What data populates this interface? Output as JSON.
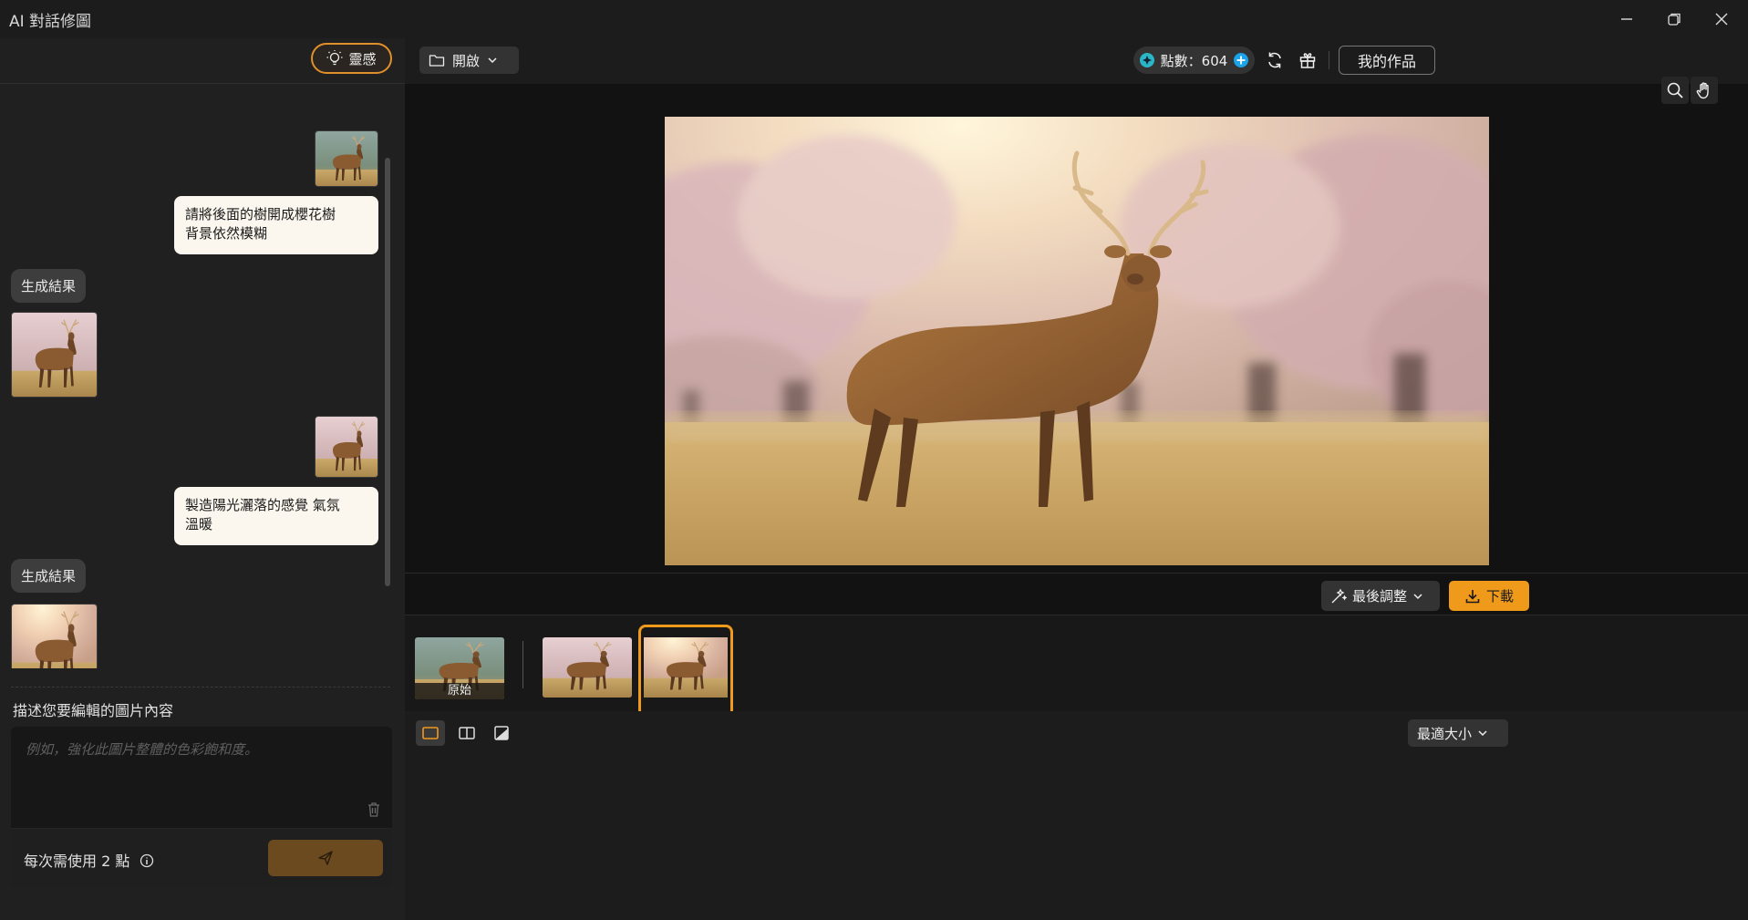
{
  "window": {
    "title": "AI 對話修圖"
  },
  "left_panel": {
    "inspiration_label": "靈感",
    "messages": [
      {
        "role": "user",
        "text": "請將後面的樹開成櫻花樹\n背景依然模糊"
      },
      {
        "role": "assistant",
        "tag": "生成結果"
      },
      {
        "role": "user",
        "text": "製造陽光灑落的感覺 氣氛\n溫暖"
      },
      {
        "role": "assistant",
        "tag": "生成結果"
      }
    ],
    "description_label": "描述您要編輯的圖片內容",
    "input_placeholder": "例如，強化此圖片整體的色彩飽和度。",
    "input_value": "",
    "cost_text": "每次需使用 2 點"
  },
  "toolbar": {
    "open_label": "開啟",
    "points_label": "點數：604",
    "my_works_label": "我的作品"
  },
  "canvas": {
    "final_adjust_label": "最後調整",
    "download_label": "下載"
  },
  "filmstrip": {
    "items": [
      {
        "label": "原始",
        "selected": false
      },
      {
        "label": "",
        "selected": false
      },
      {
        "label": "",
        "selected": true
      }
    ]
  },
  "bottom": {
    "fit_label": "最適大小"
  },
  "colors": {
    "accent": "#f09a1c",
    "background": "#121212",
    "panel": "#202020"
  }
}
